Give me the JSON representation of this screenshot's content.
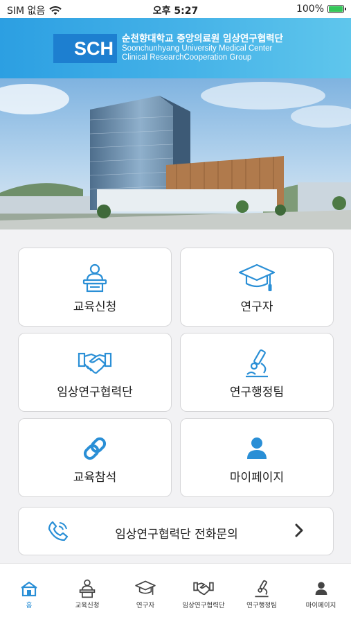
{
  "status_bar": {
    "carrier": "SIM 없음",
    "time": "오후 5:27",
    "battery_percent": "100%"
  },
  "header": {
    "logo": "SCH",
    "title_kr": "순천향대학교 중앙의료원 임상연구협력단",
    "title_en_line1": "Soonchunhyang University Medical Center",
    "title_en_line2": "Clinical ResearchCooperation Group"
  },
  "menu": {
    "items": [
      {
        "label": "교육신청",
        "icon": "lecturer-icon"
      },
      {
        "label": "연구자",
        "icon": "graduation-cap-icon"
      },
      {
        "label": "임상연구협력단",
        "icon": "handshake-icon"
      },
      {
        "label": "연구행정팀",
        "icon": "microscope-icon"
      },
      {
        "label": "교육참석",
        "icon": "link-icon"
      },
      {
        "label": "마이페이지",
        "icon": "user-icon"
      }
    ],
    "phone_inquiry": "임상연구협력단 전화문의"
  },
  "tabbar": {
    "items": [
      {
        "label": "홈",
        "icon": "home-icon"
      },
      {
        "label": "교육신청",
        "icon": "lecturer-icon"
      },
      {
        "label": "연구자",
        "icon": "graduation-cap-icon"
      },
      {
        "label": "임상연구협력단",
        "icon": "handshake-icon"
      },
      {
        "label": "연구행정팀",
        "icon": "microscope-icon"
      },
      {
        "label": "마이페이지",
        "icon": "user-icon"
      }
    ],
    "active": "홈"
  },
  "colors": {
    "accent": "#2a8fd6",
    "header_gradient_start": "#2c9fe2",
    "header_gradient_end": "#5fc6ec",
    "logo_block": "#1d7fd0",
    "battery": "#34c759"
  }
}
